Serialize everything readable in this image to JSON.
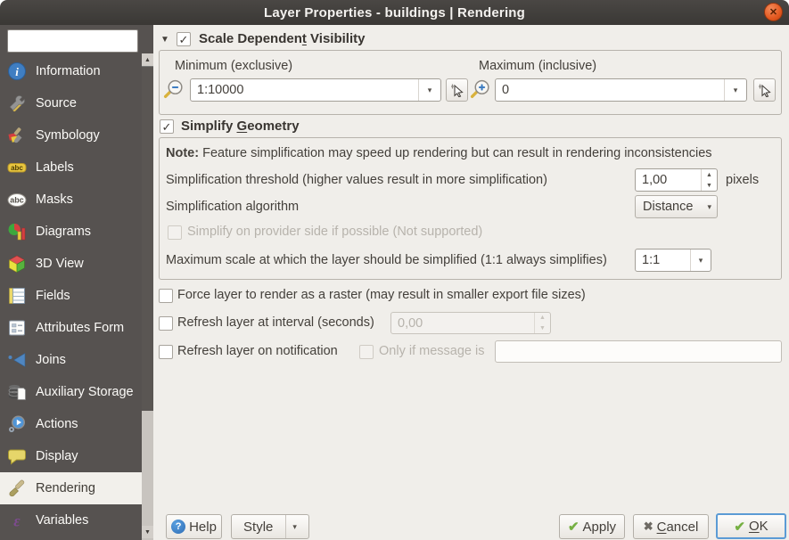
{
  "window": {
    "title": "Layer Properties - buildings | Rendering",
    "close_glyph": "✕"
  },
  "icons": {
    "check": "✓",
    "expander_down": "▼",
    "combo_arrow": "▾",
    "spin_up": "▲",
    "spin_down": "▼",
    "scroll_up": "▲",
    "scroll_down": "▼",
    "style_arrow": "▾",
    "apply_check": "✔",
    "ok_check": "✔",
    "cancel_x": "✖",
    "help_q": "?"
  },
  "colors": {
    "titlebar": "#3c3a37",
    "sidebar": "#565250",
    "selected_item_bg": "#f2f0eb",
    "close_button": "#e2571e",
    "apply_check_green": "#76b043",
    "ok_focus_border": "#5b9bd5"
  },
  "sidebar": {
    "search_placeholder": "",
    "items": [
      {
        "label": "Information",
        "selected": false
      },
      {
        "label": "Source",
        "selected": false
      },
      {
        "label": "Symbology",
        "selected": false
      },
      {
        "label": "Labels",
        "selected": false
      },
      {
        "label": "Masks",
        "selected": false
      },
      {
        "label": "Diagrams",
        "selected": false
      },
      {
        "label": "3D View",
        "selected": false
      },
      {
        "label": "Fields",
        "selected": false
      },
      {
        "label": "Attributes Form",
        "selected": false
      },
      {
        "label": "Joins",
        "selected": false
      },
      {
        "label": "Auxiliary Storage",
        "selected": false
      },
      {
        "label": "Actions",
        "selected": false
      },
      {
        "label": "Display",
        "selected": false
      },
      {
        "label": "Rendering",
        "selected": true
      },
      {
        "label": "Variables",
        "selected": false
      }
    ]
  },
  "scale_visibility": {
    "checked": true,
    "title_pre": "Scale Dependen",
    "title_mnemonic": "t",
    "title_post": " Visibility",
    "minimum_label": "Minimum (exclusive)",
    "minimum_value": "1:10000",
    "maximum_label": "Maximum (inclusive)",
    "maximum_value": "0"
  },
  "simplify_geometry": {
    "checked": true,
    "title_pre": "Simplify ",
    "title_mnemonic": "G",
    "title_post": "eometry",
    "note_label": "Note:",
    "note_text": " Feature simplification may speed up rendering but can result in rendering inconsistencies",
    "threshold_label": "Simplification threshold (higher values result in more simplification)",
    "threshold_value": "1,00",
    "threshold_unit": "pixels",
    "algorithm_label": "Simplification algorithm",
    "algorithm_value": "Distance",
    "provider_label": "Simplify on provider side if possible (Not supported)",
    "provider_checked": false,
    "max_scale_label": "Maximum scale at which the layer should be simplified (1:1 always simplifies)",
    "max_scale_value": "1:1"
  },
  "options": {
    "force_raster_label": "Force layer to render as a raster (may result in smaller export file sizes)",
    "force_raster_checked": false,
    "refresh_interval_label": "Refresh layer at interval (seconds)",
    "refresh_interval_checked": false,
    "refresh_interval_value": "0,00",
    "refresh_notification_label": "Refresh layer on notification",
    "refresh_notification_checked": false,
    "only_if_message_label": "Only if message is",
    "only_if_message_checked": false,
    "notification_message_value": ""
  },
  "footer": {
    "help_label": "Help",
    "style_label": "Style",
    "apply_label": "Apply",
    "cancel_mnemonic": "C",
    "cancel_post": "ancel",
    "ok_mnemonic": "O",
    "ok_post": "K"
  }
}
